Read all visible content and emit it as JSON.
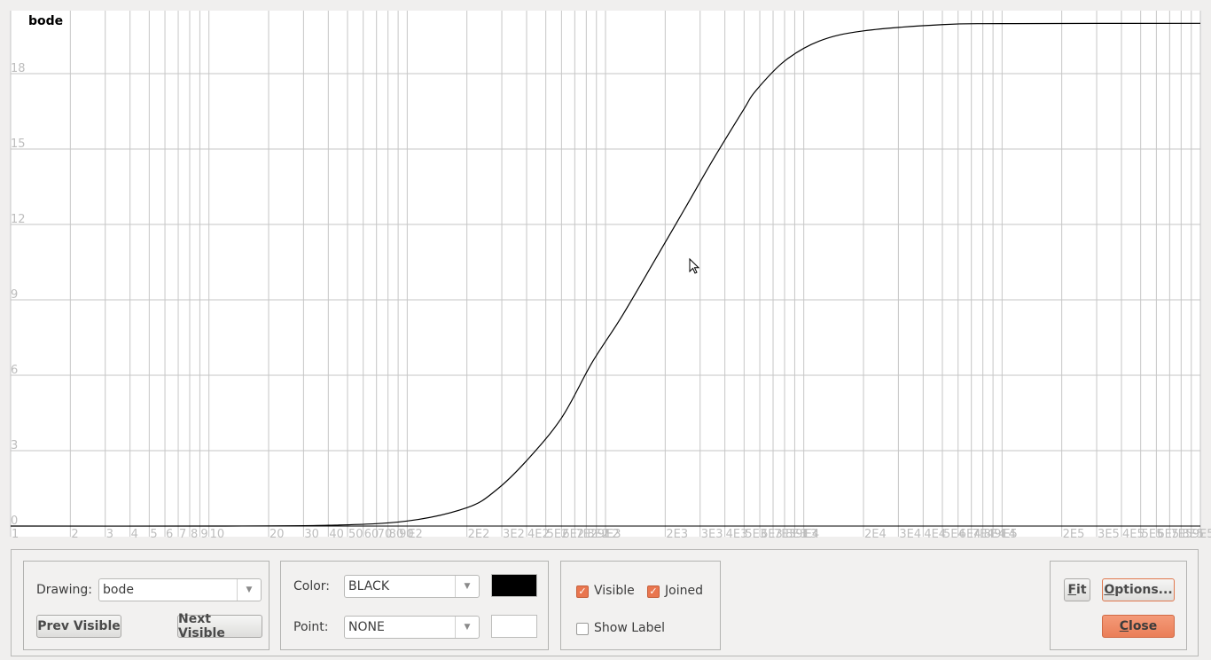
{
  "chart_data": {
    "type": "line",
    "title": "bode",
    "xscale": "log",
    "xlim": [
      1,
      1000000
    ],
    "ylim": [
      -0.3,
      20.5
    ],
    "grid": true,
    "ytick_labels": [
      "0",
      "3",
      "6",
      "9",
      "12",
      "15",
      "18"
    ],
    "yticks": [
      0,
      3,
      6,
      9,
      12,
      15,
      18
    ],
    "xtick_labels_major": [
      "1",
      "10",
      "E2",
      "E3",
      "E4",
      "E5"
    ],
    "xtick_labels": [
      "1",
      "2",
      "3",
      "4",
      "5",
      "6",
      "7",
      "8",
      "9",
      "10",
      "20",
      "30",
      "40",
      "50",
      "60",
      "70",
      "80",
      "90",
      "E2",
      "2E2",
      "3E2",
      "4E2",
      "5E2",
      "6E2",
      "7E2",
      "8E2",
      "9E2",
      "E3",
      "2E3",
      "3E3",
      "4E3",
      "5E3",
      "6E3",
      "7E3",
      "8E3",
      "9E3",
      "E4",
      "2E4",
      "3E4",
      "4E4",
      "5E4",
      "6E4",
      "7E4",
      "8E4",
      "9E4",
      "E5",
      "2E5",
      "3E5",
      "4E5",
      "5E5",
      "6E5",
      "7E5",
      "8E5",
      "9E5"
    ],
    "series": [
      {
        "name": "bode",
        "color": "#000000",
        "x": [
          1,
          10,
          40,
          100,
          200,
          280,
          400,
          600,
          855,
          1200,
          1780,
          2500,
          3500,
          5000,
          5700,
          8000,
          12000,
          20000,
          50000,
          100000,
          1000000
        ],
        "y": [
          0.0,
          0.0,
          0.03,
          0.2,
          0.73,
          1.42,
          2.6,
          4.3,
          6.5,
          8.3,
          10.6,
          12.6,
          14.6,
          16.6,
          17.3,
          18.5,
          19.3,
          19.7,
          19.95,
          19.99,
          20.0
        ]
      }
    ]
  },
  "controls": {
    "drawing_label": "Drawing:",
    "drawing_value": "bode",
    "prev_visible": "Prev Visible",
    "next_visible": "Next Visible",
    "color_label": "Color:",
    "color_value": "BLACK",
    "color_swatch": "#000000",
    "point_label": "Point:",
    "point_value": "NONE",
    "point_swatch": "#ffffff",
    "visible_label": "Visible",
    "visible_checked": true,
    "joined_label": "Joined",
    "joined_checked": true,
    "show_label_label": "Show Label",
    "show_label_checked": false,
    "fit_label_u": "F",
    "fit_label_rest": "it",
    "options_label_u": "O",
    "options_label_rest": "ptions...",
    "close_label_u": "C",
    "close_label_rest": "lose",
    "accent_color": "#e9764f"
  }
}
